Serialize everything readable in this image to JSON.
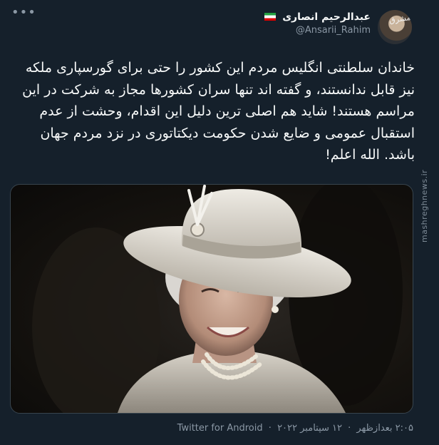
{
  "user": {
    "display_name": "عبدالرحیم انصاری",
    "handle": "@Ansarii_Rahim",
    "avatar_logo": "مشرق"
  },
  "tweet": {
    "text": "خاندان سلطنتی انگلیس مردم این کشور را حتی برای گورسپاری ملکه نیز قابل ندانستند، و گفته اند تنها سران کشورها مجاز به شرکت در این مراسم هستند! شاید هم اصلی ترین دلیل این اقدام، وحشت از عدم استقبال عمومی و ضایع شدن حکومت دیکتاتوری در نزد مردم جهان باشد. الله اعلم!",
    "time": "۲:۰۵ بعدازظهر",
    "date": "۱۲ سپتامبر ۲۰۲۲",
    "source": "Twitter for Android",
    "separator": "·"
  },
  "watermark": "mashreghnews.ir",
  "icons": {
    "more": "more-options-icon",
    "flag": "iran-flag-icon"
  },
  "colors": {
    "background": "#15202b",
    "text": "#f7f9f9",
    "muted": "#8b98a5",
    "border": "#38444d"
  }
}
